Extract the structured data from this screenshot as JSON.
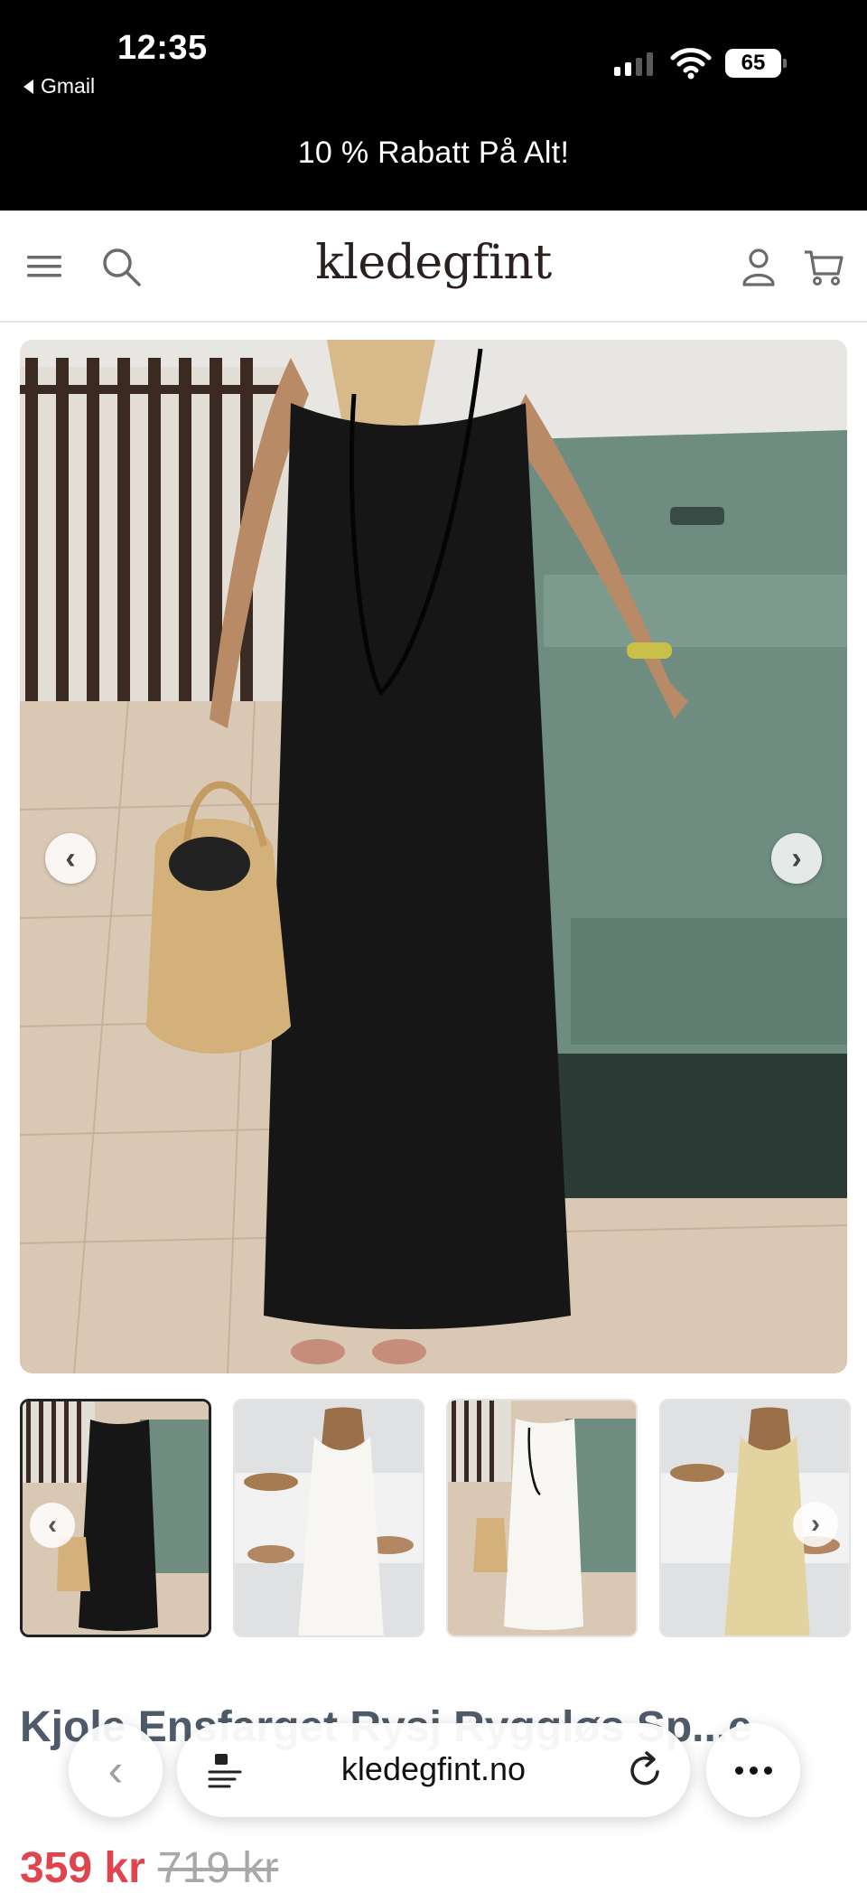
{
  "status_bar": {
    "time": "12:35",
    "back_app": "Gmail",
    "battery": "65"
  },
  "promo": {
    "text": "10 % Rabatt På Alt!"
  },
  "header": {
    "logo": "kledegfint",
    "icons": [
      "menu-icon",
      "search-icon",
      "account-icon",
      "cart-icon"
    ]
  },
  "gallery": {
    "main_image": "black maxi dress",
    "thumbnails": [
      "black dress",
      "white dress back",
      "white dress front",
      "beige dress back"
    ],
    "active_index": 0
  },
  "product": {
    "title": "Kjole Ensfarget Rysj Ryggløs Sp...e",
    "price": "359 kr",
    "old_price": "719 kr"
  },
  "browser": {
    "url": "kledegfint.no"
  },
  "colors": {
    "price": "#e0444f",
    "title": "#3c4a5c",
    "status_bg": "#000000"
  }
}
